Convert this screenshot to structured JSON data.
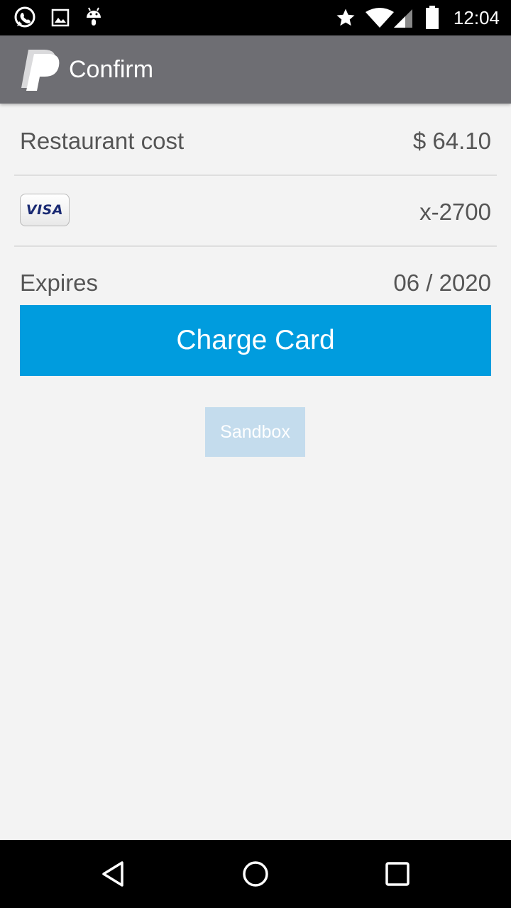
{
  "status_bar": {
    "time": "12:04",
    "left_icons": [
      "whatsapp-icon",
      "image-icon",
      "android-icon"
    ],
    "right_icons": [
      "star-icon",
      "wifi-icon",
      "signal-icon",
      "battery-icon"
    ]
  },
  "app_bar": {
    "logo": "paypal-logo",
    "title": "Confirm"
  },
  "summary": {
    "cost_label": "Restaurant cost",
    "cost_value": "$ 64.10",
    "card_brand": "VISA",
    "card_number": "x-2700",
    "expires_label": "Expires",
    "expires_value": "06 / 2020"
  },
  "actions": {
    "charge_label": "Charge Card",
    "environment_badge": "Sandbox"
  },
  "colors": {
    "app_bar": "#6e6e73",
    "charge_button": "#009cde",
    "sandbox_badge": "#c4dced",
    "background": "#f3f3f3"
  },
  "nav_bar": {
    "buttons": [
      "back-icon",
      "home-icon",
      "recents-icon"
    ]
  }
}
